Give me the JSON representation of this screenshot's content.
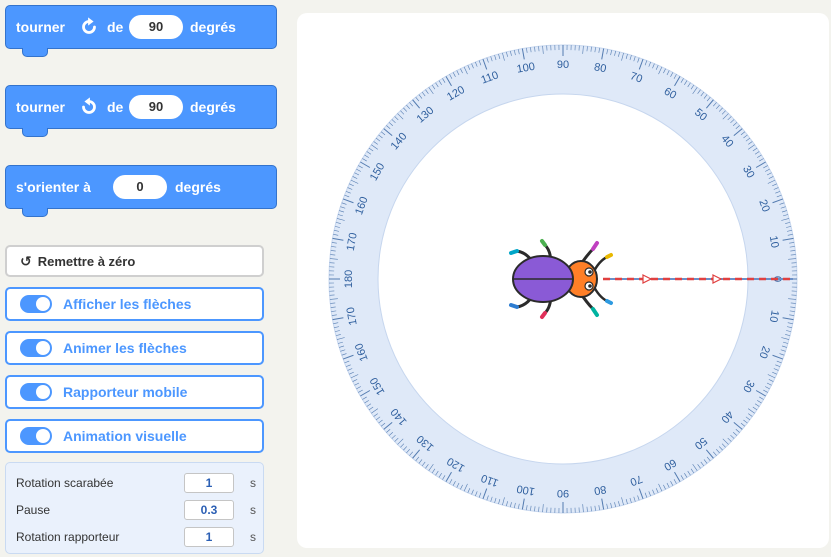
{
  "blocks": {
    "turn_right": {
      "label": "tourner",
      "icon": "rotate-clockwise-icon",
      "de": "de",
      "value": "90",
      "unit": "degrés"
    },
    "turn_left": {
      "label": "tourner",
      "icon": "rotate-counterclockwise-icon",
      "de": "de",
      "value": "90",
      "unit": "degrés"
    },
    "point": {
      "label": "s'orienter à",
      "value": "0",
      "unit": "degrés"
    }
  },
  "reset": {
    "icon": "reset-icon",
    "glyph": "↺",
    "label": "Remettre à zéro"
  },
  "toggles": [
    {
      "label": "Afficher les flèches",
      "on": true
    },
    {
      "label": "Animer les flèches",
      "on": true
    },
    {
      "label": "Rapporteur mobile",
      "on": true
    },
    {
      "label": "Animation visuelle",
      "on": true
    }
  ],
  "settings": [
    {
      "label": "Rotation scarabée",
      "value": "1",
      "unit": "s"
    },
    {
      "label": "Pause",
      "value": "0.3",
      "unit": "s"
    },
    {
      "label": "Rotation rapporteur",
      "value": "1",
      "unit": "s"
    }
  ],
  "stage": {
    "protractor": {
      "labels": [
        "0",
        "10",
        "20",
        "30",
        "40",
        "50",
        "60",
        "70",
        "80",
        "90",
        "100",
        "110",
        "120",
        "130",
        "140",
        "150",
        "160",
        "170",
        "180",
        "170",
        "160",
        "150",
        "140",
        "130",
        "120",
        "110",
        "100",
        "90",
        "80",
        "70",
        "60",
        "50",
        "40",
        "30",
        "20",
        "10"
      ],
      "ring_color": "#dfe9f8",
      "text_color": "#2f5f9e"
    },
    "beetle": {
      "heading_deg": 0,
      "body_color": "#8a5ad6",
      "head_color": "#ff7f27"
    },
    "arrow_color": "#e04040"
  }
}
